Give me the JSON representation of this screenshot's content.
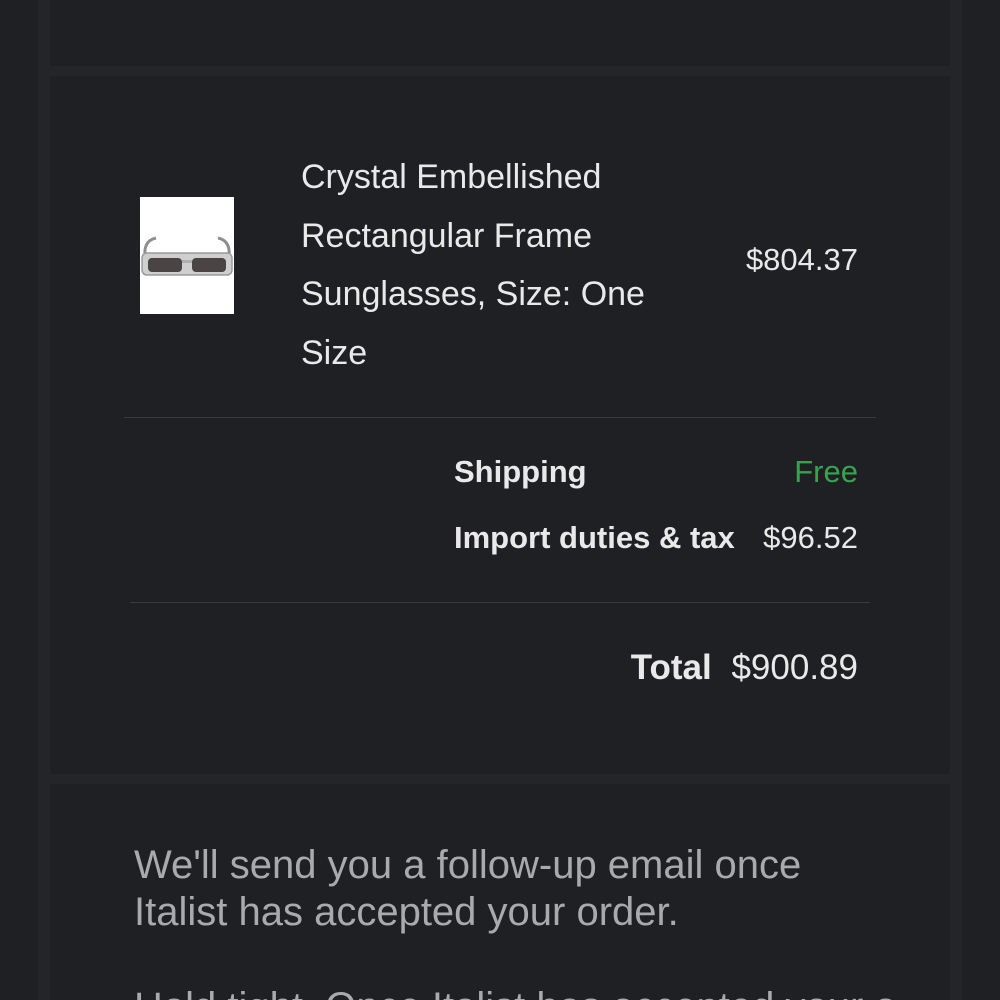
{
  "order": {
    "product": {
      "name": "Crystal Embellished Rectangular Frame Sunglasses, Size: One Size",
      "price": "$804.37",
      "image_icon": "sunglasses-image"
    },
    "shipping": {
      "label": "Shipping",
      "value": "Free"
    },
    "duties": {
      "label": "Import duties & tax",
      "value": "$96.52"
    },
    "total": {
      "label": "Total",
      "value": "$900.89"
    }
  },
  "note": {
    "message": "We'll send you a follow-up email once Italist has accepted your order.",
    "next_line_partial": "Hold tight. Once Italist has accepted your order"
  },
  "colors": {
    "background": "#242528",
    "card": "#1f2024",
    "text": "#e9e9ea",
    "muted_text": "#a9aaad",
    "free_green": "#37a34f"
  }
}
